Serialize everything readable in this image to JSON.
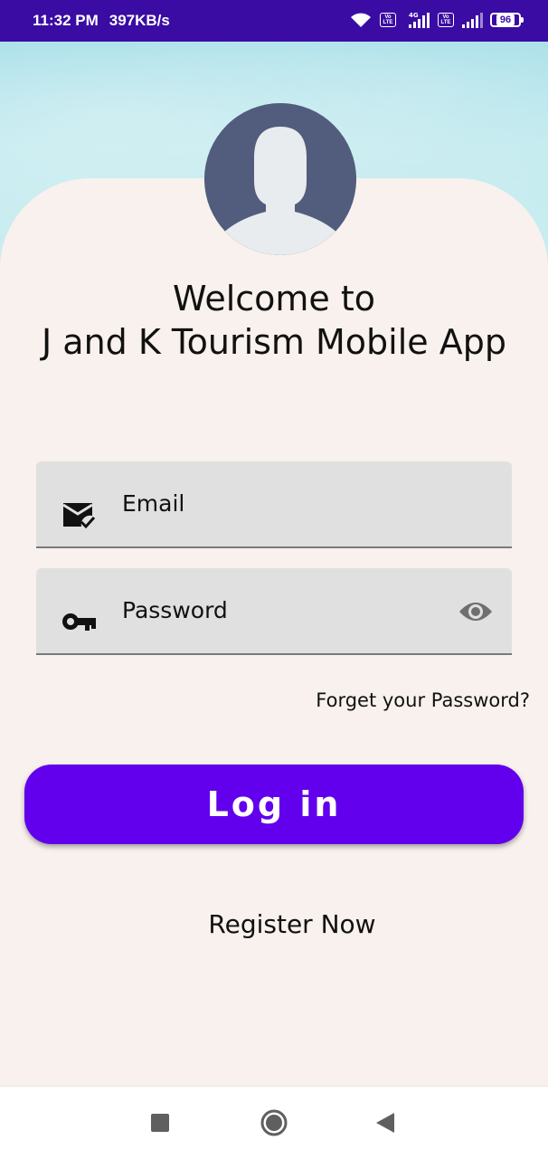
{
  "status_bar": {
    "time": "11:32 PM",
    "speed": "397KB/s",
    "network_label": "4G",
    "lte_label": "Vo LTE",
    "battery": "96"
  },
  "header": {
    "title_line1": "Welcome to",
    "title_line2": "J and K Tourism Mobile App"
  },
  "form": {
    "email": {
      "placeholder": "Email",
      "icon": "mail-check-icon"
    },
    "password": {
      "placeholder": "Password",
      "icon": "key-icon",
      "toggle_icon": "eye-icon"
    },
    "forgot_label": "Forget your Password?",
    "login_label": "Log in",
    "register_label": "Register Now"
  },
  "nav": {
    "recent_icon": "square-icon",
    "home_icon": "circle-icon",
    "back_icon": "triangle-back-icon"
  },
  "colors": {
    "status_bar": "#3a0ca3",
    "card": "#f9f1ed",
    "primary": "#6200ee",
    "field": "#e0e0e0",
    "avatar": "#525d7d"
  }
}
